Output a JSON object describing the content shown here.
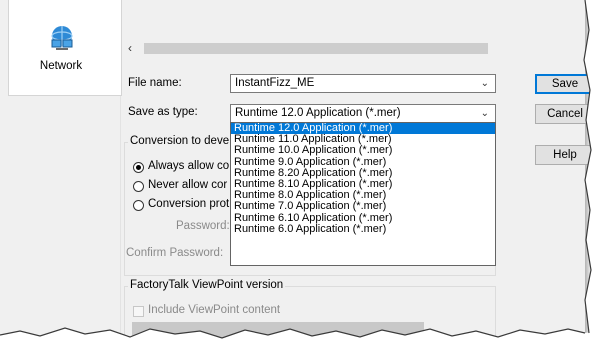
{
  "places": {
    "network_label": "Network"
  },
  "form": {
    "file_name_label": "File name:",
    "file_name_value": "InstantFizz_ME",
    "save_type_label": "Save as type:",
    "save_type_value": "Runtime 12.0 Application (*.mer)"
  },
  "buttons": {
    "save": "Save",
    "cancel": "Cancel",
    "help": "Help"
  },
  "conversion_group": {
    "title": "Conversion to deve",
    "options": [
      "Always allow co",
      "Never allow cor",
      "Conversion prot"
    ],
    "password_label": "Password:",
    "confirm_label": "Confirm Password:"
  },
  "dropdown_options": [
    "Runtime 12.0 Application (*.mer)",
    "Runtime 11.0 Application (*.mer)",
    "Runtime 10.0 Application (*.mer)",
    "Runtime 9.0 Application (*.mer)",
    "Runtime 8.20 Application (*.mer)",
    "Runtime 8.10 Application (*.mer)",
    "Runtime 8.0 Application (*.mer)",
    "Runtime 7.0 Application (*.mer)",
    "Runtime 6.10 Application (*.mer)",
    "Runtime 6.0 Application (*.mer)"
  ],
  "viewpoint_group": {
    "title": "FactoryTalk ViewPoint version",
    "checkbox_label": "Include ViewPoint content"
  },
  "colors": {
    "selection": "#0078d7",
    "dialog_bg": "#f0f0f0"
  },
  "icons": {
    "network": "network-icon",
    "dropdown": "chevron-down-icon",
    "scroll_left": "chevron-left-icon"
  }
}
